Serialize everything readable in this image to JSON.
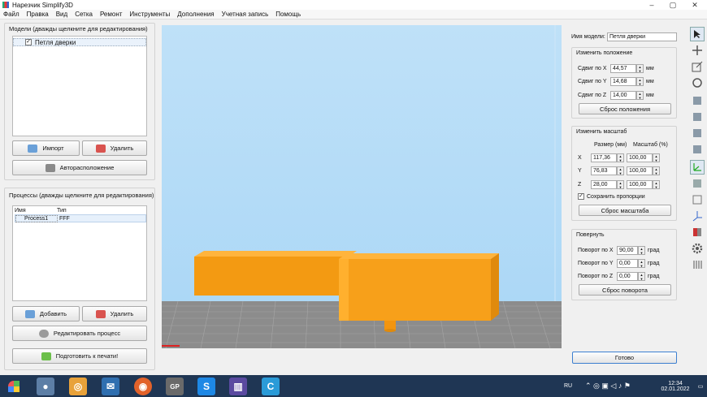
{
  "window": {
    "title": "Нарезчик Simplify3D"
  },
  "menu": [
    "Файл",
    "Правка",
    "Вид",
    "Сетка",
    "Ремонт",
    "Инструменты",
    "Дополнения",
    "Учетная запись",
    "Помощь"
  ],
  "models": {
    "title": "Модели (дважды щелкните для редактирования)",
    "items": [
      {
        "label": "Петля дверки",
        "checked": true
      }
    ],
    "import_label": "Импорт",
    "delete_label": "Удалить",
    "autoplace_label": "Авторасположение"
  },
  "processes": {
    "title": "Процессы (дважды щелкните для редактирования)",
    "col_name": "Имя",
    "col_type": "Тип",
    "rows": [
      {
        "name": "Process1",
        "type": "FFF"
      }
    ],
    "add_label": "Добавить",
    "delete_label": "Удалить",
    "edit_label": "Редактировать процесс",
    "prepare_label": "Подготовить к печати!"
  },
  "model_panel": {
    "name_label": "Имя модели:",
    "name_value": "Петля дверки",
    "position": {
      "title": "Изменить положение",
      "x_label": "Сдвиг по X",
      "x_value": "44,57",
      "y_label": "Сдвиг по Y",
      "y_value": "14,68",
      "z_label": "Сдвиг по Z",
      "z_value": "14,00",
      "unit": "мм",
      "reset_label": "Сброс положения"
    },
    "scale": {
      "title": "Изменить масштаб",
      "size_header": "Размер (мм)",
      "percent_header": "Масштаб (%)",
      "rows": [
        {
          "axis": "X",
          "size": "117,36",
          "percent": "100,00"
        },
        {
          "axis": "Y",
          "size": "76,83",
          "percent": "100,00"
        },
        {
          "axis": "Z",
          "size": "28,00",
          "percent": "100,00"
        }
      ],
      "keep_ratio_label": "Сохранить пропорции",
      "reset_label": "Сброс масштаба"
    },
    "rotate": {
      "title": "Повернуть",
      "x_label": "Поворот по X",
      "x_value": "90,00",
      "y_label": "Поворот по Y",
      "y_value": "0,00",
      "z_label": "Поворот по Z",
      "z_value": "0,00",
      "unit": "град",
      "reset_label": "Сброс поворота"
    },
    "done_label": "Готово"
  },
  "tray": {
    "lang": "RU",
    "time": "12:34",
    "date": "02.01.2022"
  },
  "colors": {
    "model": "#ffa41c",
    "viewport_sky": "#b6dcf7",
    "bed": "#8a8a8a",
    "taskbar": "#1f3654"
  }
}
